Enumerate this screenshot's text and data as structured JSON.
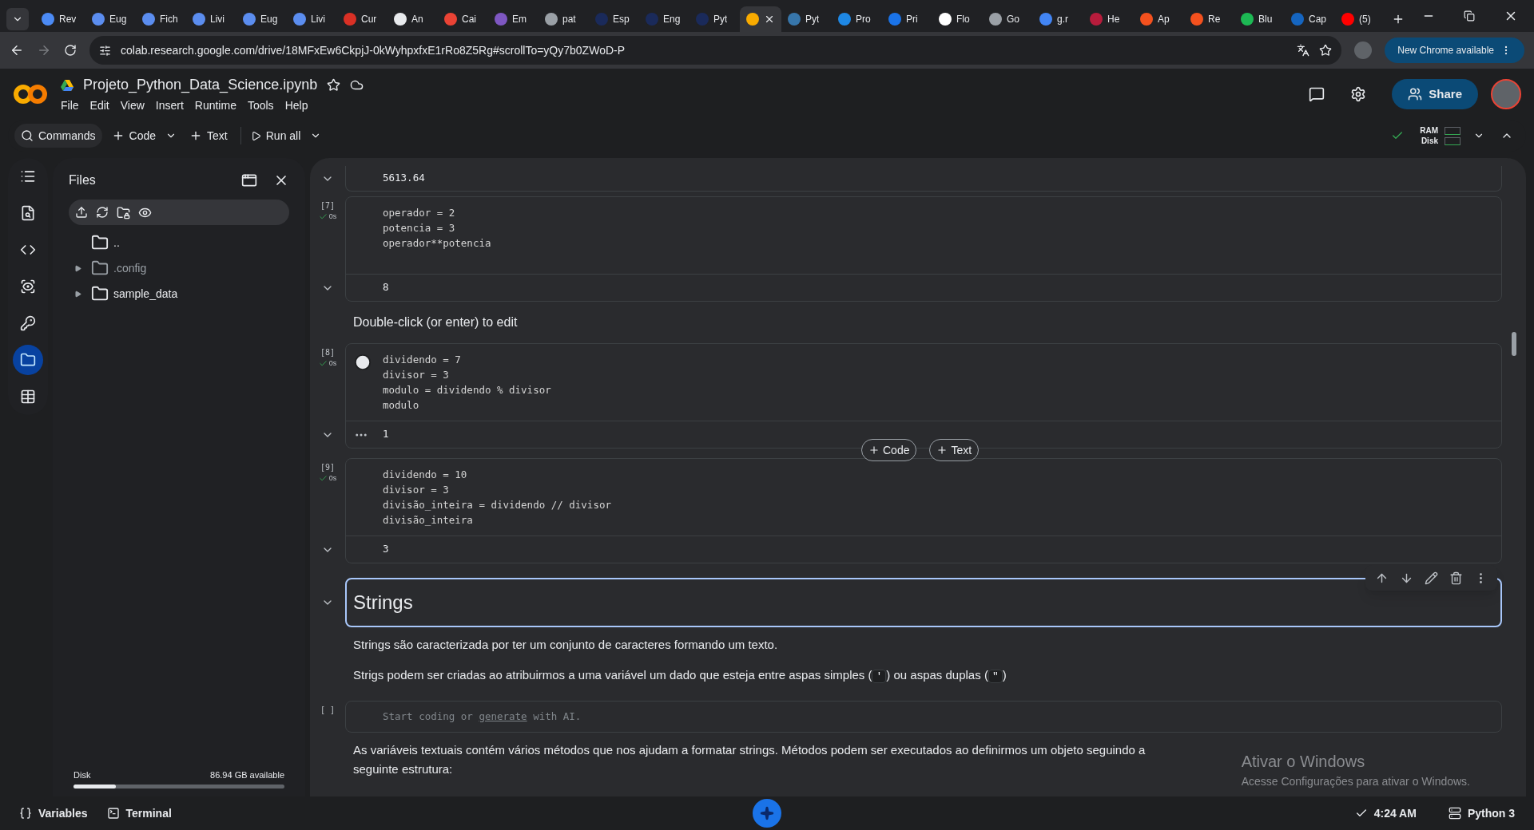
{
  "browser": {
    "tabs": [
      {
        "label": "Rev",
        "color": "#4c8bf5",
        "selected": false
      },
      {
        "label": "Eug",
        "color": "#5b8def",
        "selected": false
      },
      {
        "label": "Fich",
        "color": "#5b8def",
        "selected": false
      },
      {
        "label": "Livi",
        "color": "#5b8def",
        "selected": false
      },
      {
        "label": "Eug",
        "color": "#5b8def",
        "selected": false
      },
      {
        "label": "Livi",
        "color": "#5b8def",
        "selected": false
      },
      {
        "label": "Cur",
        "color": "#d93025",
        "selected": false
      },
      {
        "label": "An",
        "color": "#e8eaed",
        "selected": false
      },
      {
        "label": "Cai",
        "color": "#ea4335",
        "selected": false
      },
      {
        "label": "Em",
        "color": "#7e57c2",
        "selected": false
      },
      {
        "label": "pat",
        "color": "#9aa0a6",
        "selected": false
      },
      {
        "label": "Esp",
        "color": "#1a2a5a",
        "selected": false
      },
      {
        "label": "Eng",
        "color": "#1a2a5a",
        "selected": false
      },
      {
        "label": "Pyt",
        "color": "#1a2a5a",
        "selected": false
      },
      {
        "color": "#f9ab00",
        "selected": true
      },
      {
        "label": "Pyt",
        "color": "#3776ab",
        "selected": false
      },
      {
        "label": "Pro",
        "color": "#1e88e5",
        "selected": false
      },
      {
        "label": "Pri",
        "color": "#1a73e8",
        "selected": false
      },
      {
        "label": "Flo",
        "color": "#ffffff",
        "selected": false
      },
      {
        "label": "Go",
        "color": "#9aa0a6",
        "selected": false
      },
      {
        "label": "g.r",
        "color": "#4285f4",
        "selected": false
      },
      {
        "label": "He",
        "color": "#b71c3c",
        "selected": false
      },
      {
        "label": "Ap",
        "color": "#f4511e",
        "selected": false
      },
      {
        "label": "Re",
        "color": "#f4511e",
        "selected": false
      },
      {
        "label": "Blu",
        "color": "#1db954",
        "selected": false
      },
      {
        "label": "Cap",
        "color": "#1565c0",
        "selected": false
      },
      {
        "label": "(5)",
        "color": "#ff0000",
        "selected": false
      }
    ],
    "url": "colab.research.google.com/drive/18MFxEw6CkpjJ-0kWyhpxfxE1rRo8Z5Rg#scrollTo=yQy7b0ZWoD-P",
    "update_button": "New Chrome available"
  },
  "notebook": {
    "title": "Projeto_Python_Data_Science.ipynb",
    "menu": [
      "File",
      "Edit",
      "View",
      "Insert",
      "Runtime",
      "Tools",
      "Help"
    ],
    "share": "Share"
  },
  "toolbar": {
    "commands": "Commands",
    "add_code": "Code",
    "add_text": "Text",
    "run_all": "Run all",
    "ram": "RAM",
    "disk": "Disk"
  },
  "sidebar": {
    "items": [
      {
        "kind": "toc",
        "selected": false
      },
      {
        "kind": "find",
        "selected": false
      },
      {
        "kind": "snippets",
        "selected": false
      },
      {
        "kind": "variables",
        "selected": false
      },
      {
        "kind": "secrets",
        "selected": false
      },
      {
        "kind": "files",
        "selected": true
      },
      {
        "kind": "data",
        "selected": false
      }
    ]
  },
  "files": {
    "title": "Files",
    "items": [
      {
        "name": "..",
        "expandable": false,
        "muted": false
      },
      {
        "name": ".config",
        "expandable": true,
        "muted": true
      },
      {
        "name": "sample_data",
        "expandable": true,
        "muted": false
      }
    ],
    "disk": {
      "label": "Disk",
      "free": "86.94 GB available",
      "level": 0.2
    }
  },
  "cells": [
    {
      "kind": "output",
      "output": "5613.64"
    },
    {
      "kind": "code",
      "count": "[7]",
      "time": "0s",
      "hovered": false,
      "lines": [
        "operador = 2",
        "potencia = 3",
        "operador**potencia"
      ],
      "output": "8"
    },
    {
      "kind": "text",
      "text": "Double-click (or enter) to edit"
    },
    {
      "kind": "code",
      "count": "[8]",
      "time": "0s",
      "hovered": true,
      "lines": [
        "dividendo = 7",
        "divisor = 3",
        "modulo = dividendo % divisor",
        "modulo"
      ],
      "output": "1"
    },
    {
      "kind": "code",
      "count": "[9]",
      "time": "0s",
      "hovered": false,
      "lines": [
        "dividendo = 10",
        "divisor = 3",
        "divisão_inteira = dividendo // divisor",
        "divisão_inteira"
      ],
      "output": "3"
    },
    {
      "kind": "heading",
      "text": "Strings",
      "selected": true
    },
    {
      "kind": "paragraph",
      "parts": [
        {
          "kind": "text",
          "text": "Strings são caracterizada por ter um conjunto de caracteres formando um texto."
        }
      ]
    },
    {
      "kind": "paragraph",
      "parts": [
        {
          "kind": "text",
          "text": "Strigs podem ser criadas ao atribuirmos a uma variável um dado que esteja entre aspas simples ("
        },
        {
          "kind": "code",
          "text": "'"
        },
        {
          "kind": "text",
          "text": ") ou aspas duplas ("
        },
        {
          "kind": "code",
          "text": "\""
        },
        {
          "kind": "text",
          "text": ")"
        }
      ]
    },
    {
      "kind": "empty",
      "count": "[ ]",
      "before": "Start coding or ",
      "link": "generate",
      "after": " with AI."
    },
    {
      "kind": "paragraph",
      "parts": [
        {
          "kind": "text",
          "text": "As variáveis textuais contém vários métodos que nos ajudam a formatar strings. Métodos podem ser executados ao definirmos um objeto seguindo a seguinte estrutura:"
        }
      ]
    }
  ],
  "insert_buttons": [
    "Code",
    "Text"
  ],
  "windows_notice": {
    "title": "Ativar o Windows",
    "text": "Acesse Configurações para ativar o Windows."
  },
  "status_bar": {
    "variables": "Variables",
    "terminal": "Terminal",
    "time": "4:24 AM",
    "runtime": "Python 3"
  }
}
